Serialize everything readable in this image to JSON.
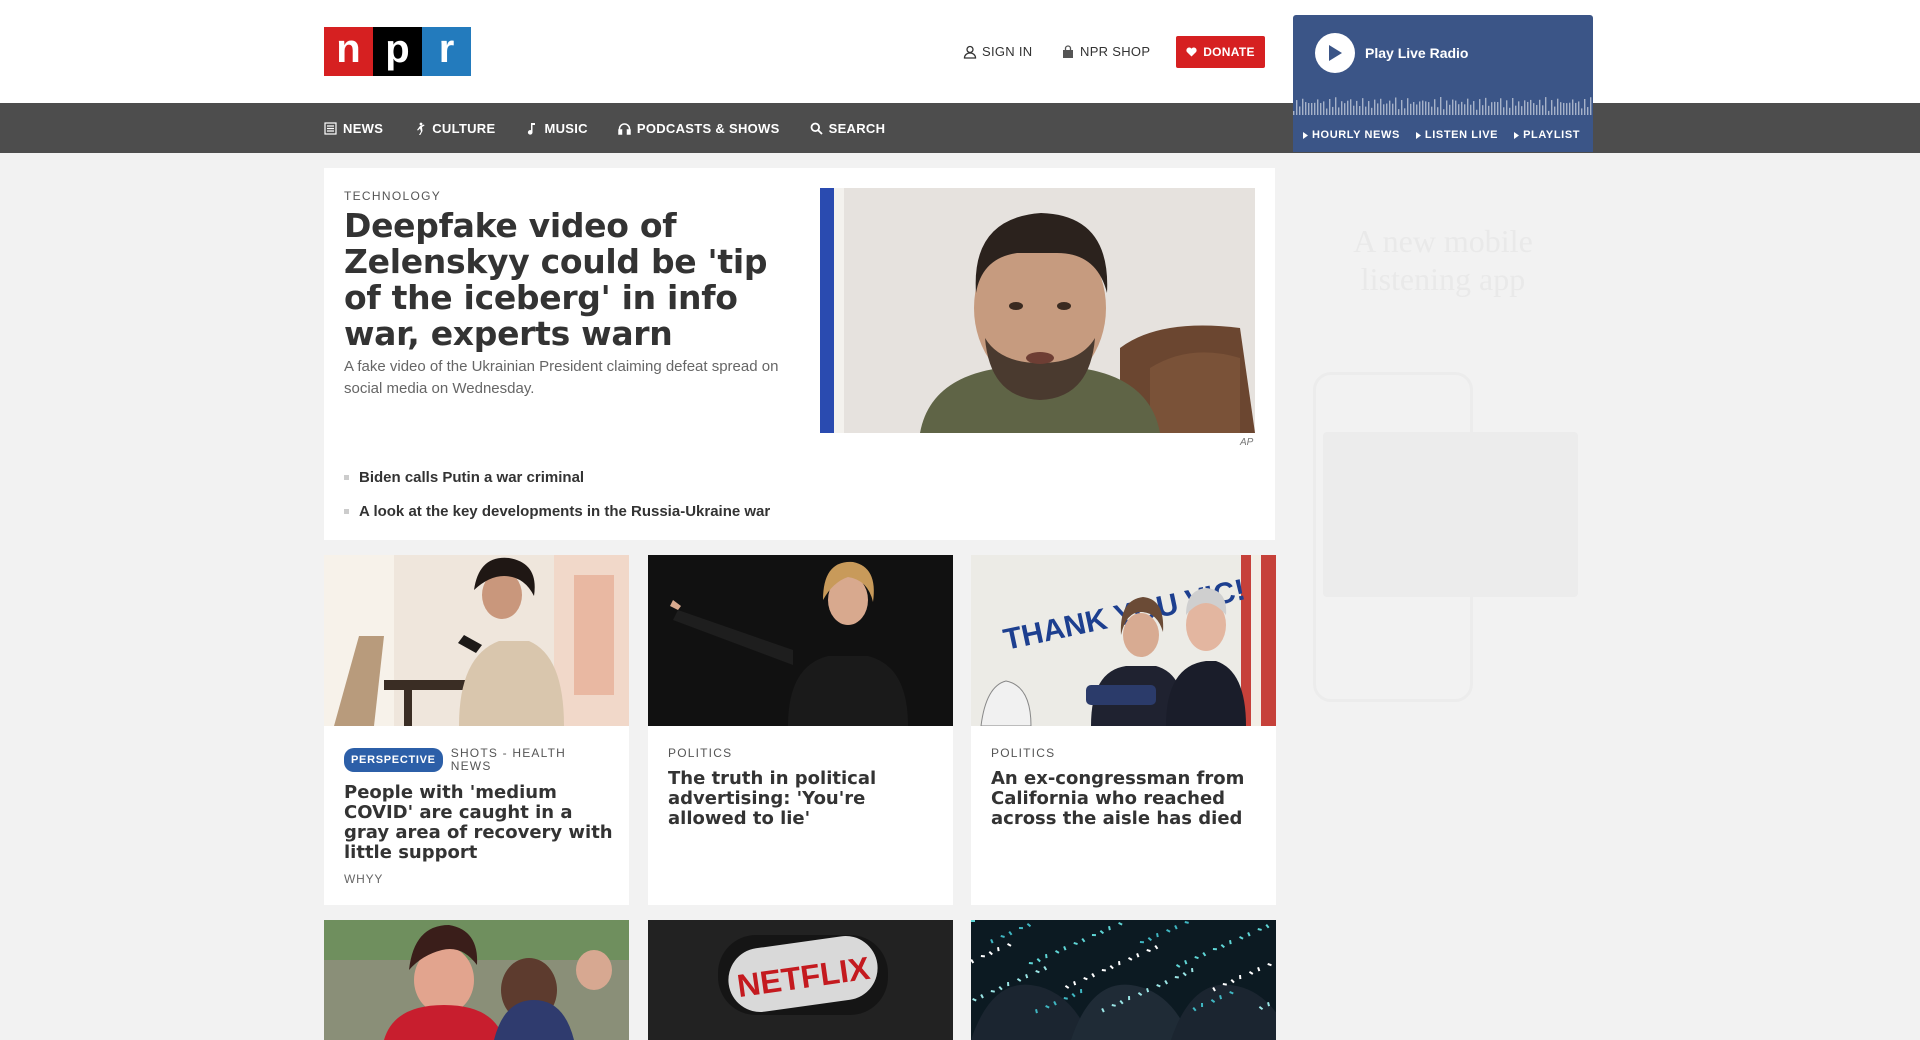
{
  "header": {
    "logo": {
      "n": "n",
      "p": "p",
      "r": "r"
    },
    "sign_in": "SIGN IN",
    "shop": "NPR SHOP",
    "donate": "DONATE"
  },
  "radio": {
    "play_label": "Play Live Radio",
    "links": [
      "HOURLY NEWS",
      "LISTEN LIVE",
      "PLAYLIST"
    ]
  },
  "nav": {
    "items": [
      "NEWS",
      "CULTURE",
      "MUSIC",
      "PODCASTS & SHOWS",
      "SEARCH"
    ]
  },
  "promo": {
    "line1": "A new mobile",
    "line2": "listening app"
  },
  "lead": {
    "slug": "TECHNOLOGY",
    "headline": "Deepfake video of Zelenskyy could be 'tip of the iceberg' in info war, experts warn",
    "teaser": "A fake video of the Ukrainian President claiming defeat spread on social media on Wednesday.",
    "credit": "AP",
    "related": [
      "Biden calls Putin a war criminal",
      "A look at the key developments in the Russia-Ukraine war"
    ]
  },
  "cards": [
    {
      "badge": "PERSPECTIVE",
      "slug": "SHOTS - HEALTH NEWS",
      "headline": "People with 'medium COVID' are caught in a gray area of recovery with little support",
      "source": "WHYY"
    },
    {
      "slug": "POLITICS",
      "headline": "The truth in political advertising: 'You're allowed to lie'"
    },
    {
      "slug": "POLITICS",
      "headline": "An ex-congressman from California who reached across the aisle has died",
      "sign_text": "THANK YOU VIC!"
    }
  ],
  "bottom_cards": [
    {
      "logo_text": ""
    },
    {
      "logo_text": "NETFLIX"
    },
    {
      "logo_text": ""
    }
  ],
  "colors": {
    "npr_red": "#d62021",
    "npr_blue": "#237bbd",
    "radio_blue": "#3b5587",
    "nav_gray": "#4d4d4d",
    "badge_blue": "#2c5fa8"
  }
}
